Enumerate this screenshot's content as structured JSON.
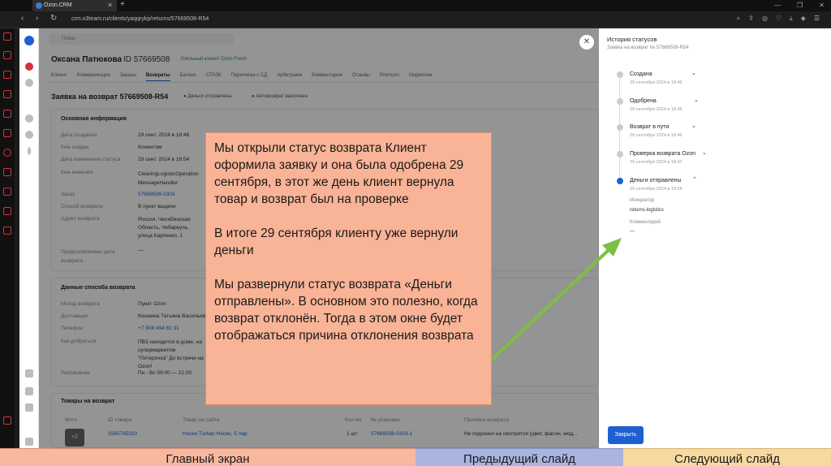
{
  "browser": {
    "tab_title": "Ozon.CRM",
    "url": "crm.o3team.ru/clients/yaqqrykp/returns/57669508-R54"
  },
  "crm": {
    "search_placeholder": "Поиск",
    "customer_name": "Оксана Патюкова",
    "customer_id": "ID 57669508",
    "loyalty_badge": "Лояльный клиент Ozon Fresh",
    "tabs": [
      "Клиент",
      "Коммуникации",
      "Заказы",
      "Возвраты",
      "Баланс",
      "СТАЗК",
      "Переписка с СД",
      "Арбитражи",
      "Комментарии",
      "Отзывы",
      "Premium",
      "Маркетинг"
    ],
    "active_tab": "Возвраты",
    "return_title": "Заявка на возврат 57669508-R54",
    "status_money": "Деньги отправлены",
    "status_auto": "Автовозврат выполнен",
    "basic_info": {
      "title": "Основная информация",
      "rows": [
        {
          "label": "Дата создания",
          "value": "29 сент. 2024 в 18:46"
        },
        {
          "label": "Кем создан",
          "value": "Клиентом"
        },
        {
          "label": "Дата изменения статуса",
          "value": "29 сент. 2024 в 18:54"
        },
        {
          "label": "Кем изменён",
          "value": "ClearingLogisticOperation MessageHandler"
        },
        {
          "label": "Заказ",
          "value": "57669508-0303"
        },
        {
          "label": "Способ возврата",
          "value": "В пункт выдачи"
        },
        {
          "label": "Адрес возврата",
          "value": "Россия, Челябинская Область, Чебаркуль, улица Карпенко, 1"
        },
        {
          "label": "Предполагаемая дата возврата",
          "value": "—"
        }
      ]
    },
    "method_info": {
      "title": "Данные способа возврата",
      "rows": [
        {
          "label": "Метод возврата",
          "value": "Пункт Ozon"
        },
        {
          "label": "Доставщик",
          "value": "Кошкина Татьяна Васильевна"
        },
        {
          "label": "Телефон",
          "value": "+7 908 494 81 31"
        },
        {
          "label": "Как добраться",
          "value": "ПВЗ находится в доме, на супермаркетом \"Пятерочка\" До встречи на Ozon!"
        },
        {
          "label": "Расписание",
          "value": "Пн - Вс   09:00 — 21:00"
        }
      ]
    },
    "goods": {
      "title": "Товары на возврат",
      "columns": [
        "Фото",
        "ID товара",
        "Товар на сайте",
        "Кол-во",
        "№ упаковки",
        "Причина возврата"
      ],
      "row": {
        "photo_badge": "+2",
        "id": "1565765333",
        "name": "Носки Turkan Носки, 5 пар",
        "qty": "1 шт",
        "package": "57669508-0303-1",
        "reason": "Не подошел на смотрится (цвет, фасон, мод..."
      }
    }
  },
  "history": {
    "title": "История статусов",
    "subtitle": "Заявка на возврат № 57669508-R54",
    "items": [
      {
        "name": "Создана",
        "date": "29 сентября 2024 в 18:46"
      },
      {
        "name": "Одобрена",
        "date": "29 сентября 2024 в 18:46"
      },
      {
        "name": "Возврат в пути",
        "date": "29 сентября 2024 в 18:46"
      },
      {
        "name": "Проверка возврата Ozon",
        "date": "29 сентября 2024 в 18:47"
      },
      {
        "name": "Деньги отправлены",
        "date": "29 сентября 2024 в 18:54"
      }
    ],
    "initiator_label": "Инициатор",
    "initiator_value": "returns-logistics",
    "comment_label": "Комментарий",
    "comment_value": "—",
    "close_button": "Закрыть"
  },
  "note": {
    "p1": "Мы открыли статус возврата Клиент оформила заявку и она была одобрена 29 сентября, в этот же день клиент вернула товар и возврат был на проверке",
    "p2": "В итоге 29 сентября клиенту уже вернули деньги",
    "p3": "Мы развернули статус возврата «Деньги отправлены». В основном это полезно, когда возврат отклонён. Тогда в этом окне будет отображаться причина отклонения возврата"
  },
  "slides": {
    "home": "Главный экран",
    "prev": "Предыдущий слайд",
    "next": "Следующий слайд"
  },
  "colors": {
    "accent": "#1f5fd1",
    "note_bg": "#f9b396",
    "arrow": "#7ac143"
  }
}
